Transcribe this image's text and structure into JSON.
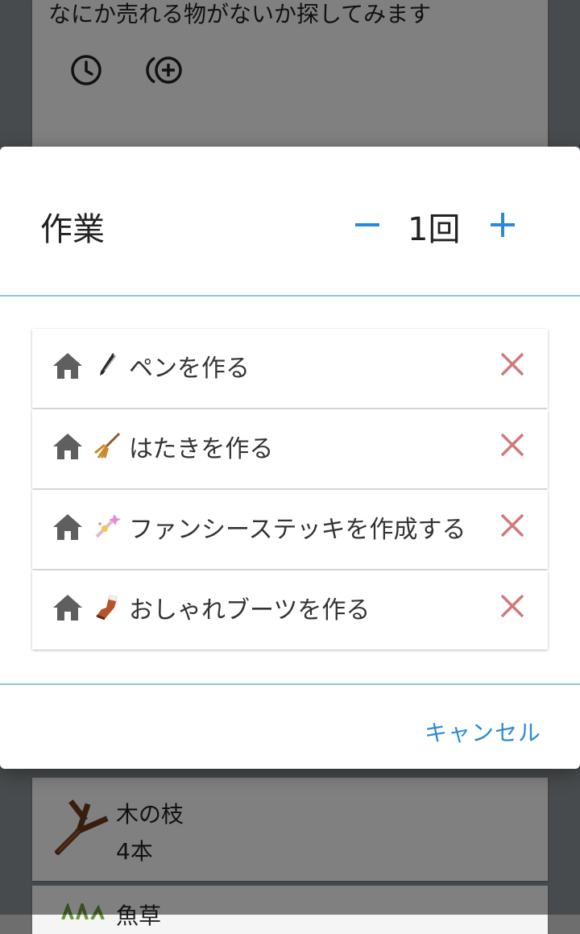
{
  "background": {
    "top_card_text": "なにか売れる物がないか探してみます",
    "clock_icon": "clock-icon",
    "add_repeat_icon": "repeat-add-icon",
    "material": {
      "name": "木の枝",
      "count": "4本",
      "icon": "branch-icon"
    },
    "material2": {
      "name": "魚草",
      "icon": "herb-icon"
    }
  },
  "dialog": {
    "title": "作業",
    "quantity": "1回",
    "minus_icon": "minus-icon",
    "plus_icon": "plus-icon",
    "tasks": [
      {
        "label": "ペンを作る",
        "location_icon": "home-icon",
        "item_icon": "pen-icon",
        "remove_icon": "close-icon"
      },
      {
        "label": "はたきを作る",
        "location_icon": "home-icon",
        "item_icon": "duster-icon",
        "remove_icon": "close-icon"
      },
      {
        "label": "ファンシーステッキを作成する",
        "location_icon": "home-icon",
        "item_icon": "fancy-stick-icon",
        "remove_icon": "close-icon"
      },
      {
        "label": "おしゃれブーツを作る",
        "location_icon": "home-icon",
        "item_icon": "boots-icon",
        "remove_icon": "close-icon"
      }
    ],
    "cancel_label": "キャンセル"
  },
  "colors": {
    "accent": "#2b8ad8",
    "divider": "#8fc3e8",
    "remove": "#cf7a7a",
    "icon_gray": "#5f5f5f"
  }
}
